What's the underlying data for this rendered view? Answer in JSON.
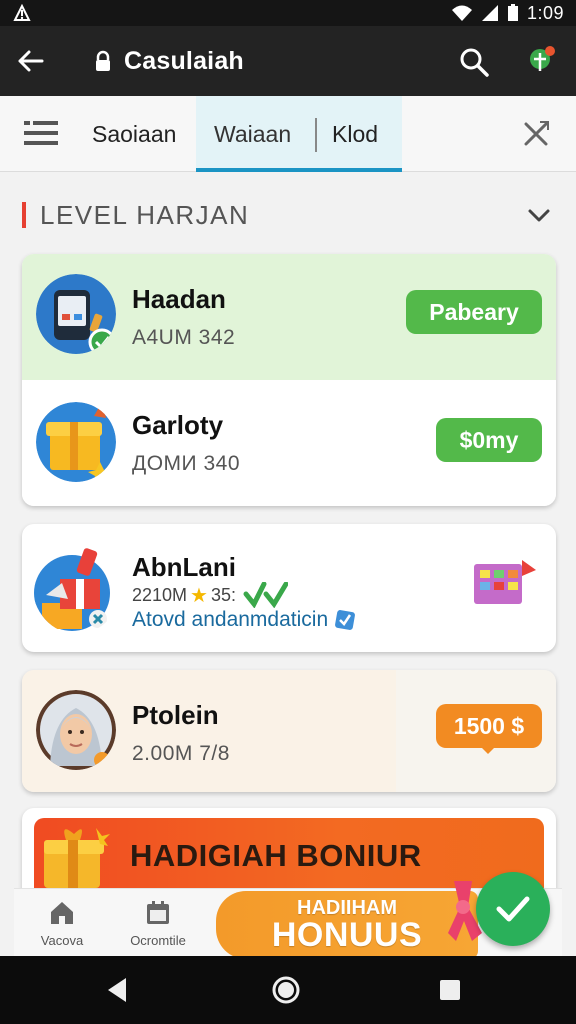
{
  "status": {
    "time": "1:09"
  },
  "appbar": {
    "title": "Casulaiah"
  },
  "tabs": [
    {
      "label": "Saoiaan"
    },
    {
      "label": "Waiaan"
    },
    {
      "label": "Klod"
    }
  ],
  "section": {
    "label": "LEVEL  HARJAN"
  },
  "items": [
    {
      "name": "Haadan",
      "sub": "A4UM  342",
      "button": "Pabeary",
      "button_color": "#53b94a"
    },
    {
      "name": "Garloty",
      "sub": "ДОМИ  340",
      "button": "$0my",
      "button_color": "#53b94a"
    },
    {
      "name": "AbnLani",
      "sub": "2210M",
      "sub2": "35:",
      "desc": "Atovd andanmdaticin"
    },
    {
      "name": "Ptolein",
      "sub": "2.00M  7/8",
      "button": "1500 $",
      "button_color": "#f28b22"
    }
  ],
  "banner": {
    "title": "HADIGIAH BONIUR"
  },
  "bottom_nav": {
    "items": [
      {
        "label": "Vacova"
      },
      {
        "label": "Ocromtile"
      }
    ],
    "promo_line1": "HADIIHAM",
    "promo_line2": "HONUUS"
  },
  "colors": {
    "accent": "#1b94c4",
    "green": "#53b94a",
    "orange": "#f28b22",
    "fab": "#2ab05a"
  }
}
